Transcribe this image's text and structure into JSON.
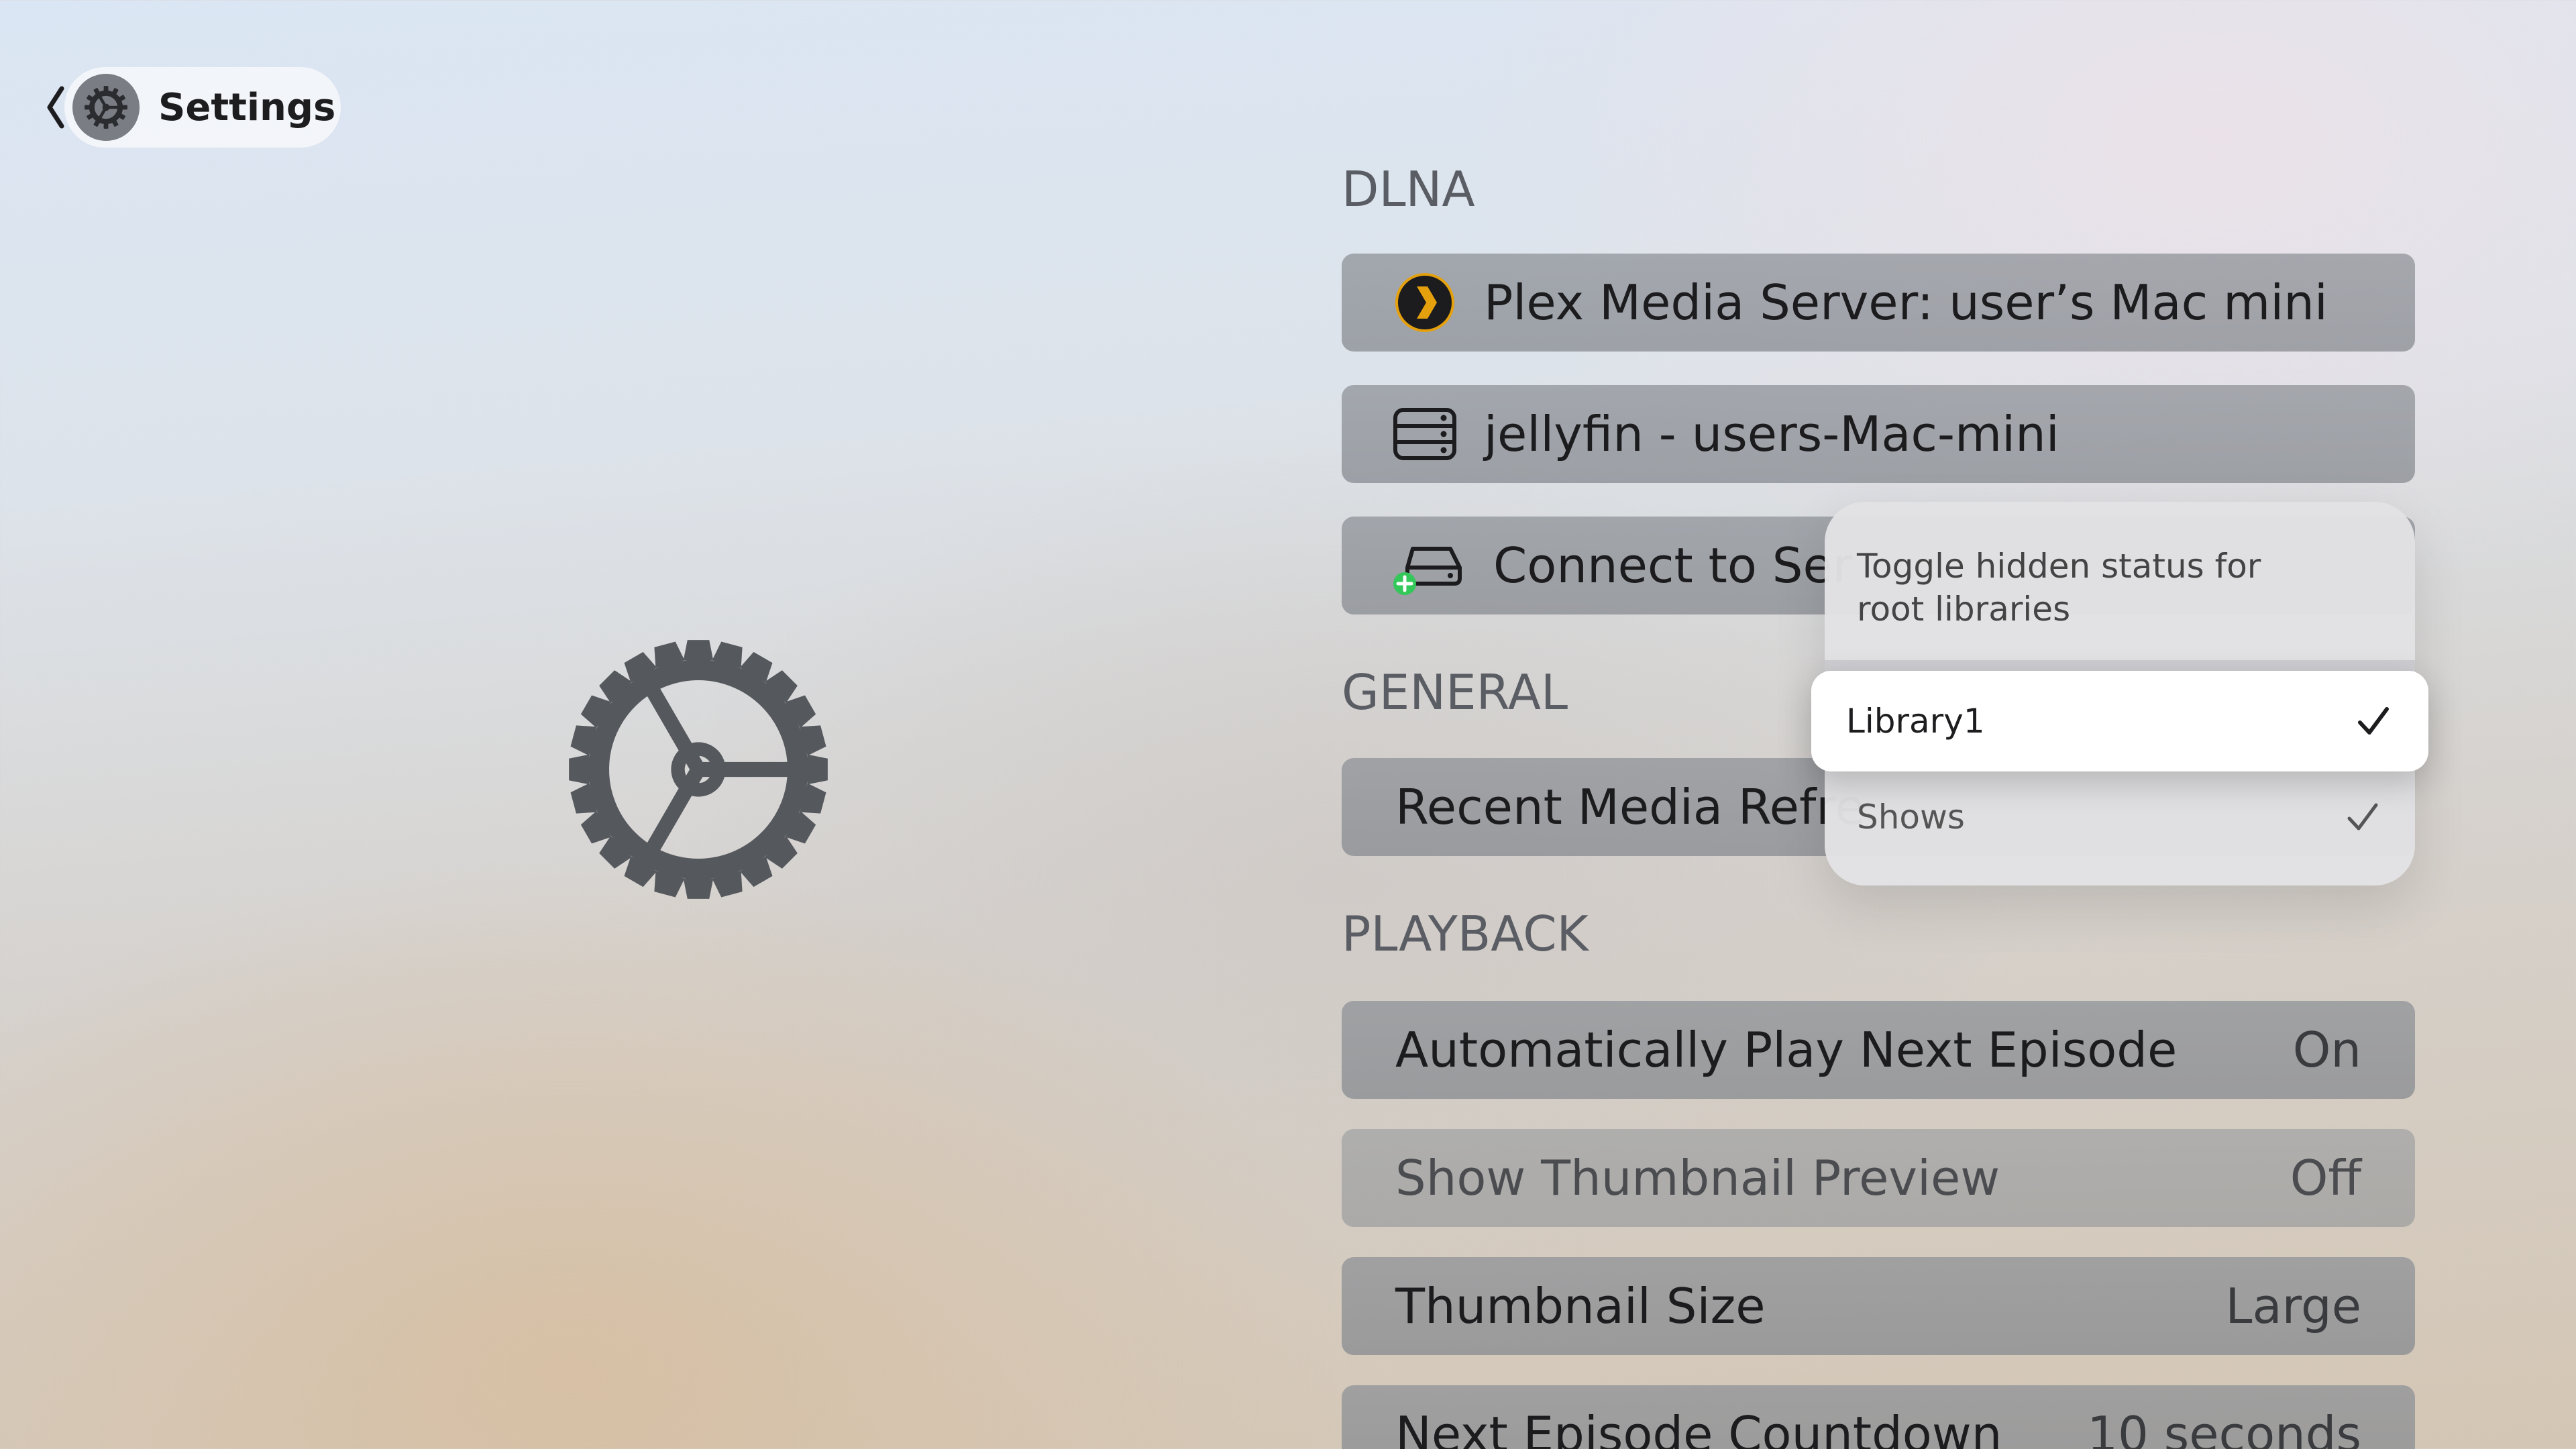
{
  "header": {
    "title": "Settings",
    "back_icon": "chevron-left-icon",
    "app_icon": "gear-icon"
  },
  "sections": {
    "dlna": {
      "header": "DLNA",
      "servers": [
        {
          "label": "Plex Media Server: user’s Mac mini",
          "icon": "plex-icon"
        },
        {
          "label": "jellyfin - users-Mac-mini",
          "icon": "server-icon"
        }
      ],
      "connect": {
        "label": "Connect to Ser",
        "icon": "add-server-icon"
      }
    },
    "general": {
      "header": "GENERAL",
      "rows": [
        {
          "label": "Recent Media Refre"
        }
      ]
    },
    "playback": {
      "header": "PLAYBACK",
      "rows": [
        {
          "label": "Automatically Play Next Episode",
          "value": "On"
        },
        {
          "label": "Show Thumbnail Preview",
          "value": "Off"
        },
        {
          "label": "Thumbnail Size",
          "value": "Large"
        },
        {
          "label": "Next Episode Countdown",
          "value": "10 seconds"
        }
      ]
    }
  },
  "popover": {
    "title": "Toggle hidden status for root libraries",
    "items": [
      {
        "label": "Library1",
        "checked": true,
        "focused": true
      },
      {
        "label": "Shows",
        "checked": true,
        "focused": false
      }
    ]
  },
  "colors": {
    "plex_accent": "#e5a00d",
    "add_badge": "#34c759",
    "row_background": "#8b8f95",
    "section_header": "#5a5d63"
  }
}
